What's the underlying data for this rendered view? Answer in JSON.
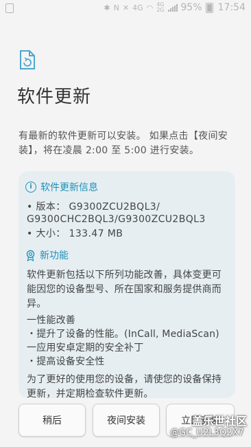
{
  "status_bar": {
    "network_labels": [
      "4G",
      "4G",
      "2G"
    ],
    "battery_percent": "95%",
    "time": "17:54",
    "icons": [
      "screenshot-icon",
      "bluetooth-icon",
      "nfc-icon",
      "mute-icon",
      "wifi-icon",
      "signal-icon",
      "battery-icon"
    ]
  },
  "page": {
    "icon": "software-update-icon",
    "title": "软件更新",
    "intro": "有最新的软件更新可以安装。 如果点击【夜间安装】，将在凌晨 2:00 至 5:00 进行安装。"
  },
  "update_info": {
    "header": "软件更新信息",
    "version_line1": "• 版本： G9300ZCU2BQL3/",
    "version_line2": "G9300CHC2BQL3/G9300ZCU2BQL3",
    "size_line": "• 大小： 133.47 MB"
  },
  "new_features": {
    "header": "新功能",
    "description": "软件更新包括以下所列功能改善，具体变更可能因您的设备型号、所在国家和服务提供商而异。",
    "items": [
      "一性能改善",
      "・提升了设备的性能。(InCall, MediaScan)",
      "一应用安卓定期的安全补丁",
      "・提高设备安全性"
    ],
    "footer": "为了更好的使用您的设备，请使您的设备保持更新，并定期检查软件更新。"
  },
  "buttons": {
    "later": "稍后",
    "night_install": "夜间安装",
    "install_now": "立即安装"
  },
  "watermark": {
    "line1": "盖乐世社区",
    "line2": "@GC_U2L3Q2X7"
  }
}
